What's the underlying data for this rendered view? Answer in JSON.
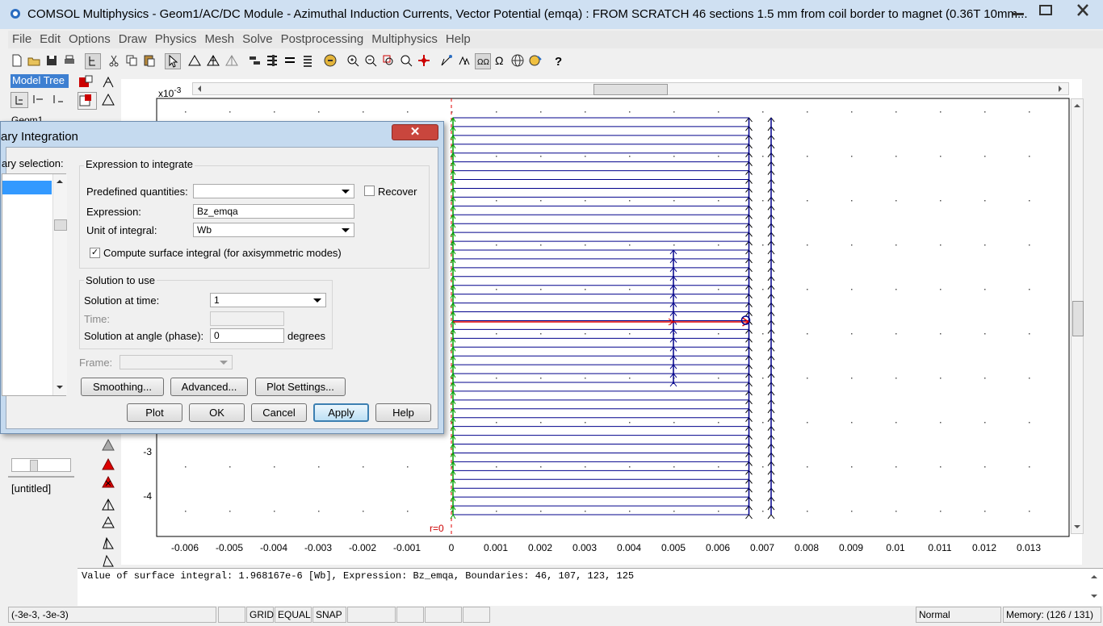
{
  "window": {
    "title": "COMSOL Multiphysics - Geom1/AC/DC Module - Azimuthal Induction Currents, Vector Potential (emqa) : FROM SCRATCH 46 sections 1.5 mm from coil border to magnet (0.36T 10mm..."
  },
  "menu": [
    "File",
    "Edit",
    "Options",
    "Draw",
    "Physics",
    "Mesh",
    "Solve",
    "Postprocessing",
    "Multiphysics",
    "Help"
  ],
  "left_panel": {
    "model_tree_label": "Model Tree",
    "geom_item": "Geom1",
    "untitled_label": "[untitled]"
  },
  "plot": {
    "x_ticks": [
      "-0.006",
      "-0.005",
      "-0.004",
      "-0.003",
      "-0.002",
      "-0.001",
      "0",
      "0.001",
      "0.002",
      "0.003",
      "0.004",
      "0.005",
      "0.006",
      "0.007",
      "0.008",
      "0.009",
      "0.01",
      "0.011",
      "0.012",
      "0.013"
    ],
    "y_ticks": [
      "-3",
      "-4"
    ],
    "y_exponent": "x10",
    "y_exponent_power": "-3",
    "axis_marker": "r=0"
  },
  "dialog": {
    "title": "ary Integration",
    "boundary_selection_label": "ary selection:",
    "expression_group_label": "Expression to integrate",
    "predefined_label": "Predefined quantities:",
    "predefined_value": "",
    "recover_label": "Recover",
    "recover_checked": false,
    "expression_label": "Expression:",
    "expression_value": "Bz_emqa",
    "unit_label": "Unit of integral:",
    "unit_value": "Wb",
    "compute_surface_label": "Compute surface integral (for axisymmetric modes)",
    "compute_surface_checked": true,
    "solution_group_label": "Solution to use",
    "solution_time_label": "Solution at time:",
    "solution_time_value": "1",
    "time_label": "Time:",
    "time_value": "",
    "angle_label": "Solution at angle (phase):",
    "angle_value": "0",
    "angle_unit": "degrees",
    "frame_label": "Frame:",
    "frame_value": "",
    "buttons": {
      "smoothing": "Smoothing...",
      "advanced": "Advanced...",
      "plot_settings": "Plot Settings...",
      "plot": "Plot",
      "ok": "OK",
      "cancel": "Cancel",
      "apply": "Apply",
      "help": "Help"
    }
  },
  "message_log": "Value of surface integral: 1.968167e-6 [Wb], Expression: Bz_emqa, Boundaries: 46, 107, 123, 125",
  "status_bar": {
    "coords": "(-3e-3, -3e-3)",
    "grid": "GRID",
    "equal": "EQUAL",
    "snap": "SNAP",
    "mode": "Normal",
    "memory": "Memory: (126 / 131)"
  },
  "colors": {
    "geometry_lines": "#00008b",
    "selected_boundary": "#e00000",
    "axis_green": "#00a000",
    "title_bar": "#cfe0f2",
    "dialog_frame": "#c5daef",
    "selection_blue": "#3399ff"
  }
}
